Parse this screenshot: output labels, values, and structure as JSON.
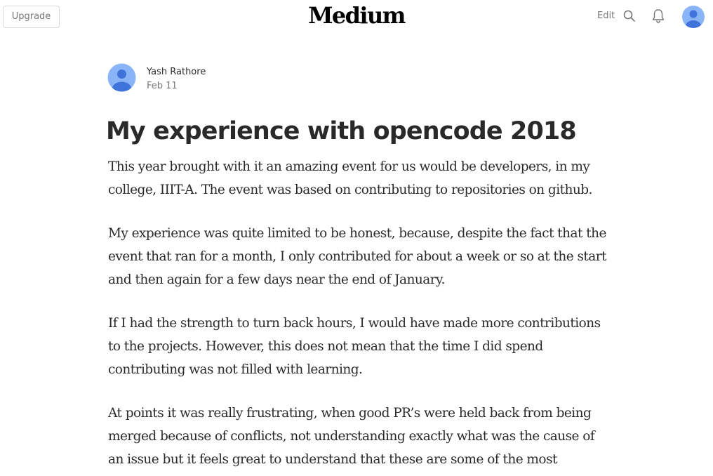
{
  "header": {
    "upgrade_label": "Upgrade",
    "logo_text": "Medium",
    "edit_label": "Edit",
    "icons": [
      "search-icon",
      "bell-icon",
      "avatar-icon"
    ]
  },
  "article": {
    "author_name": "Yash Rathore",
    "date": "Feb 11",
    "title": "My experience with opencode 2018",
    "paragraphs": [
      "This year brought with it an amazing event for us would be developers, in my college, IIIT-A. The event was based on contributing to repositories on github.",
      "My experience was quite limited to be honest, because, despite the fact that the event that ran for a month, I only contributed for about a week or so at the start and then again for a few days near the end of January.",
      "If I had the strength to turn back hours, I would have made more contributions to the projects. However, this does not mean that the time I did spend contributing was not filled with learning.",
      "At points it was really frustrating, when good PR’s were held back from being merged because of conflicts, not understanding exactly what was the cause of an issue but it feels great to understand that these are some of the most"
    ]
  },
  "colors": {
    "avatar_bg": "#8ab4f8",
    "avatar_fg": "#3f73d9",
    "text": "#292929",
    "muted": "#757575"
  }
}
